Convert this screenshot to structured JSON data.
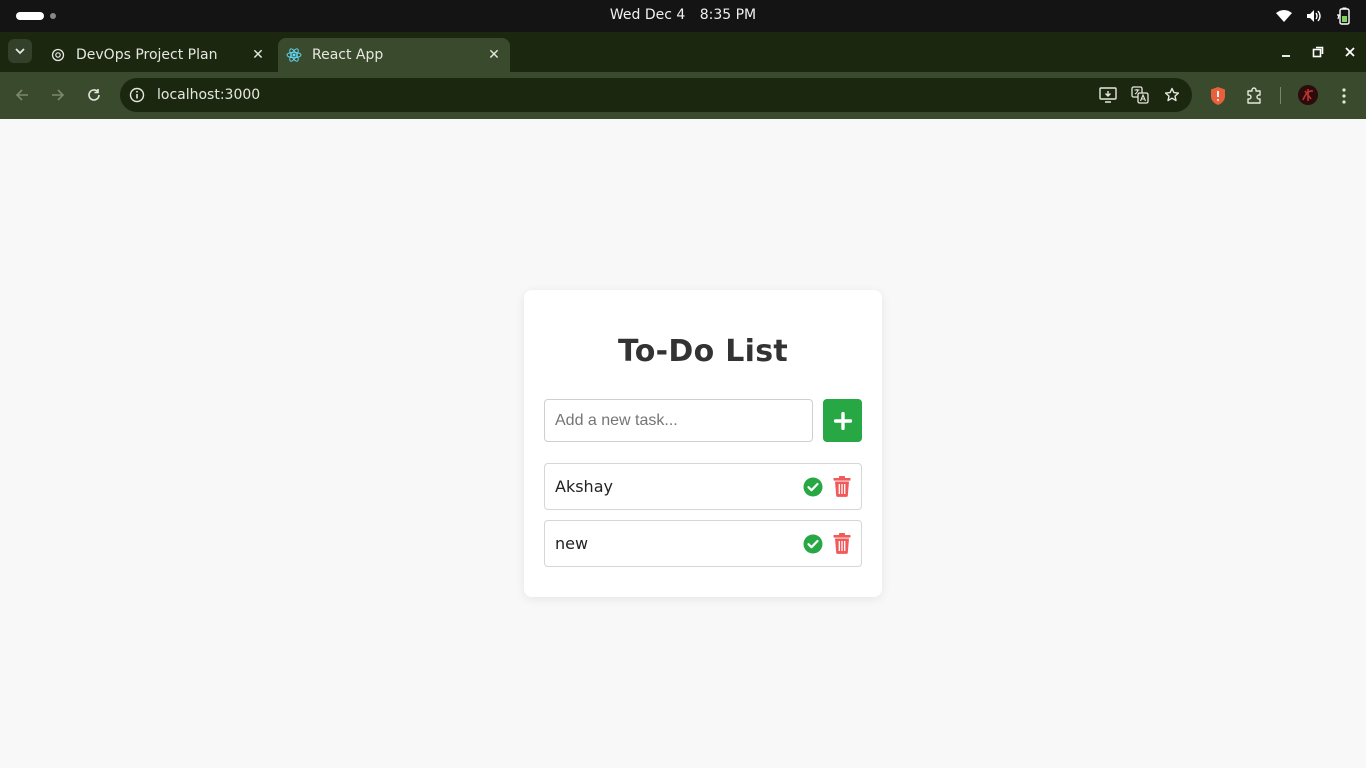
{
  "os": {
    "date": "Wed Dec 4",
    "time": "8:35 PM",
    "tray_icons": [
      "wifi-icon",
      "volume-icon",
      "battery-icon"
    ]
  },
  "browser": {
    "tabs": [
      {
        "label": "DevOps Project Plan",
        "icon": "openai-icon",
        "active": false
      },
      {
        "label": "React App",
        "icon": "react-icon",
        "active": true
      }
    ],
    "url": "localhost:3000",
    "colors": {
      "frame": "#1c2710",
      "toolbar": "#3a4a2c",
      "brave_shield": "#e8603c"
    }
  },
  "app": {
    "title": "To-Do List",
    "input": {
      "placeholder": "Add a new task...",
      "value": ""
    },
    "add_button_icon": "plus-icon",
    "tasks": [
      {
        "text": "Akshay"
      },
      {
        "text": "new"
      }
    ],
    "colors": {
      "accent": "#28a745",
      "delete": "#f05a5a",
      "title": "#333333"
    }
  }
}
